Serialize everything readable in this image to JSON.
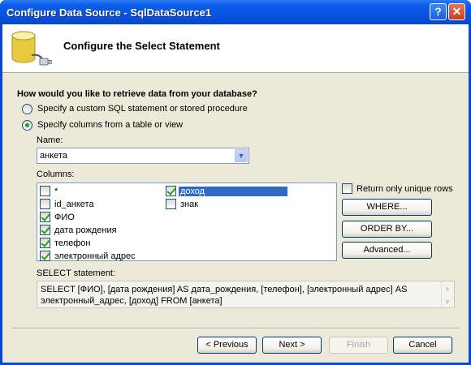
{
  "window": {
    "title": "Configure Data Source - SqlDataSource1",
    "help": "?",
    "close": "✕"
  },
  "header": {
    "title": "Configure the Select Statement"
  },
  "question": "How would you like to retrieve data from your database?",
  "options": {
    "custom_sql": "Specify a custom SQL statement or stored procedure",
    "columns_from_table": "Specify columns from a table or view",
    "selected": "columns_from_table"
  },
  "name_label": "Name:",
  "name_value": "анкета",
  "columns_label": "Columns:",
  "columns": [
    {
      "label": "*",
      "checked": false
    },
    {
      "label": "id_анкета",
      "checked": false
    },
    {
      "label": "ФИО",
      "checked": true
    },
    {
      "label": "дата рождения",
      "checked": true
    },
    {
      "label": "телефон",
      "checked": true
    },
    {
      "label": "электронный адрес",
      "checked": true
    },
    {
      "label": "доход",
      "checked": true,
      "selected": true
    },
    {
      "label": "знак",
      "checked": false
    }
  ],
  "unique_rows": {
    "label": "Return only unique rows",
    "checked": false
  },
  "side_buttons": {
    "where": "WHERE...",
    "order_by": "ORDER BY...",
    "advanced": "Advanced..."
  },
  "sql_label": "SELECT statement:",
  "sql_text": "SELECT [ФИО], [дата рождения] AS дата_рождения, [телефон], [электронный адрес] AS электронный_адрес, [доход] FROM [анкета]",
  "footer": {
    "previous": "< Previous",
    "next": "Next >",
    "finish": "Finish",
    "cancel": "Cancel"
  }
}
